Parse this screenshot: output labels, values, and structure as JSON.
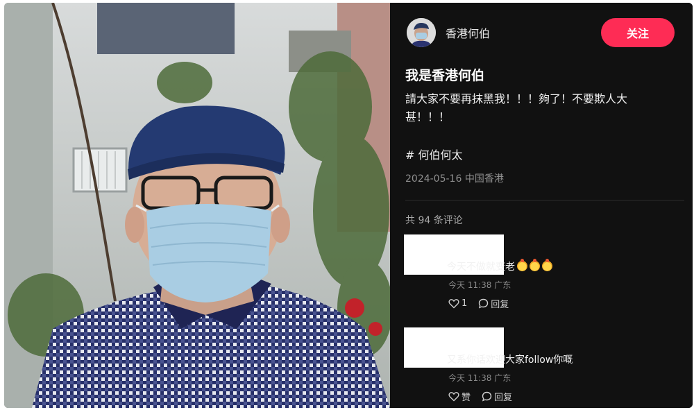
{
  "author": {
    "name": "香港何伯",
    "follow_label": "关注"
  },
  "post": {
    "title": "我是香港何伯",
    "body": "請大家不要再抹黑我！！！夠了！不要欺人大甚！！！",
    "hashtag": "# 何伯何太",
    "date": "2024-05-16",
    "location": "中国香港"
  },
  "comments_header": "共 94 条评论",
  "comments": [
    {
      "text": "今天不做就变老",
      "emoji_count": 3,
      "time": "今天 11:38",
      "region": "广东",
      "like_label": "1",
      "reply_label": "回复"
    },
    {
      "text": "又系你话欢迎大家follow你嘅",
      "time": "今天 11:38",
      "region": "广东",
      "like_label": "赞",
      "reply_label": "回复"
    }
  ],
  "icons": {
    "like": "heart-icon",
    "reply": "comment-bubble-icon"
  },
  "colors": {
    "follow_button": "#fe2c55",
    "panel_background": "#111111"
  }
}
